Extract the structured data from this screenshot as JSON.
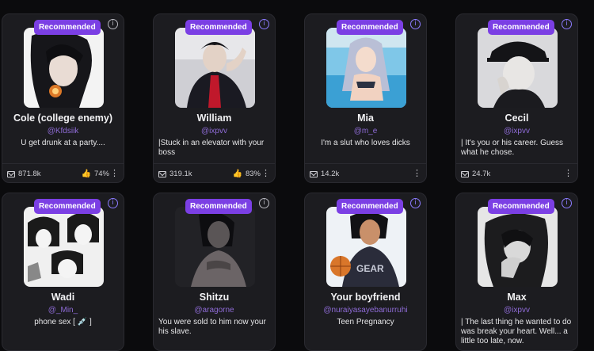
{
  "badge_label": "Recommended",
  "cards": [
    {
      "name": "Cole (college enemy)",
      "handle": "@Kfdsiik",
      "desc": "U get drunk at a party....",
      "chats": "871.8k",
      "likes": "74%"
    },
    {
      "name": "William",
      "handle": "@ixpvv",
      "desc": "|Stuck in an elevator with your boss",
      "chats": "319.1k",
      "likes": "83%"
    },
    {
      "name": "Mia",
      "handle": "@m_e",
      "desc": "I'm a slut who loves dicks",
      "chats": "14.2k",
      "likes": ""
    },
    {
      "name": "Cecil",
      "handle": "@ixpvv",
      "desc": "| It's you or his career. Guess what he chose.",
      "chats": "24.7k",
      "likes": ""
    },
    {
      "name": "Wadi",
      "handle": "@_Min_",
      "desc": "phone sex [ 💉 ]",
      "chats": "",
      "likes": ""
    },
    {
      "name": "Shitzu",
      "handle": "@aragorne",
      "desc": "You were sold to him now your his slave.",
      "chats": "",
      "likes": ""
    },
    {
      "name": "Your boyfriend",
      "handle": "@nuraiyasayebanurruhi",
      "desc": "Teen Pregnancy",
      "chats": "",
      "likes": ""
    },
    {
      "name": "Max",
      "handle": "@ixpvv",
      "desc": "| The last thing he wanted to do was break your heart. Well... a little too late, now.",
      "chats": "",
      "likes": ""
    }
  ],
  "icons": {
    "info": "info-icon",
    "chats": "message-icon",
    "likes": "thumbs-up-icon",
    "more": "more-vertical-icon"
  },
  "colors": {
    "background": "#0b0b0d",
    "card": "#1c1c20",
    "badge": "#7b3fe4",
    "handle": "#8e6bd6"
  }
}
